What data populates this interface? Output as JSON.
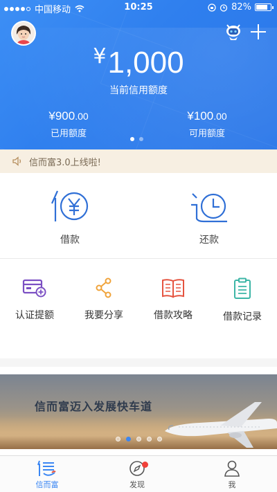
{
  "status_bar": {
    "carrier": "中国移动",
    "time": "10:25",
    "battery": "82%",
    "battery_level": 0.82
  },
  "header": {
    "avatar_icon": "avatar-icon",
    "robot_icon": "robot-assistant-icon",
    "add_icon": "plus-icon"
  },
  "credit": {
    "currency": "¥",
    "amount": "1,000",
    "label": "当前信用额度",
    "used": {
      "currency": "¥",
      "integer": "900",
      "decimal": ".00",
      "label": "已用额度"
    },
    "available": {
      "currency": "¥",
      "integer": "100",
      "decimal": ".00",
      "label": "可用额度"
    },
    "pager": {
      "count": 2,
      "active": 0
    }
  },
  "notice": {
    "icon": "speaker-icon",
    "text": "信而富3.0上线啦!"
  },
  "main_actions": [
    {
      "label": "借款",
      "icon": "borrow-yen-icon"
    },
    {
      "label": "还款",
      "icon": "repay-clock-icon"
    }
  ],
  "quick_actions": [
    {
      "label": "认证提额",
      "icon": "card-add-icon",
      "color": "#7b4fc3"
    },
    {
      "label": "我要分享",
      "icon": "share-icon",
      "color": "#f0a33a"
    },
    {
      "label": "借款攻略",
      "icon": "book-icon",
      "color": "#e5533f"
    },
    {
      "label": "借款记录",
      "icon": "clipboard-icon",
      "color": "#3cb5a6"
    }
  ],
  "banner": {
    "title": "信而富迈入发展快车道",
    "dots": {
      "count": 5,
      "active": 1
    }
  },
  "tabbar": [
    {
      "label": "信而富",
      "icon": "home-logo-icon",
      "active": true
    },
    {
      "label": "发现",
      "icon": "compass-icon",
      "active": false,
      "badge": true
    },
    {
      "label": "我",
      "icon": "person-icon",
      "active": false
    }
  ],
  "colors": {
    "primary": "#3a86f3",
    "notice_bg": "#f7efe2",
    "badge": "#f0413a"
  }
}
